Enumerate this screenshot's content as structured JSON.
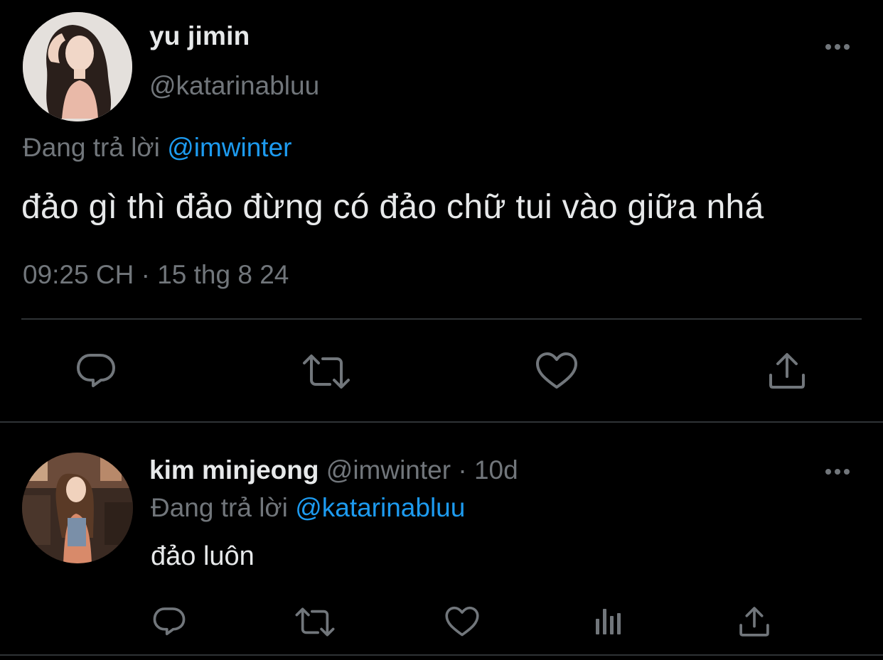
{
  "main_tweet": {
    "avatar_icon": "user-avatar-photo",
    "name": "yu jimin",
    "handle": "@katarinabluu",
    "replying_prefix": "Đang trả lời",
    "replying_to": "@imwinter",
    "text": "đảo gì thì đảo đừng có đảo chữ tui vào giữa nhá",
    "timestamp": "09:25 CH · 15 thg 8 24",
    "more_icon": "more-horizontal-icon",
    "actions": [
      "reply-icon",
      "retweet-icon",
      "like-icon",
      "share-icon"
    ]
  },
  "reply_tweet": {
    "avatar_icon": "user-avatar-photo",
    "name": "kim minjeong",
    "handle": "@imwinter",
    "separator": "·",
    "time": "10d",
    "replying_prefix": "Đang trả lời",
    "replying_to": "@katarinabluu",
    "text": "đảo luôn",
    "more_icon": "more-horizontal-icon",
    "actions": [
      "reply-icon",
      "retweet-icon",
      "like-icon",
      "views-icon",
      "share-icon"
    ]
  },
  "colors": {
    "background": "#000000",
    "primary_text": "#e7e9ea",
    "secondary_text": "#71767b",
    "accent": "#1d9bf0",
    "divider": "#2f3336"
  }
}
